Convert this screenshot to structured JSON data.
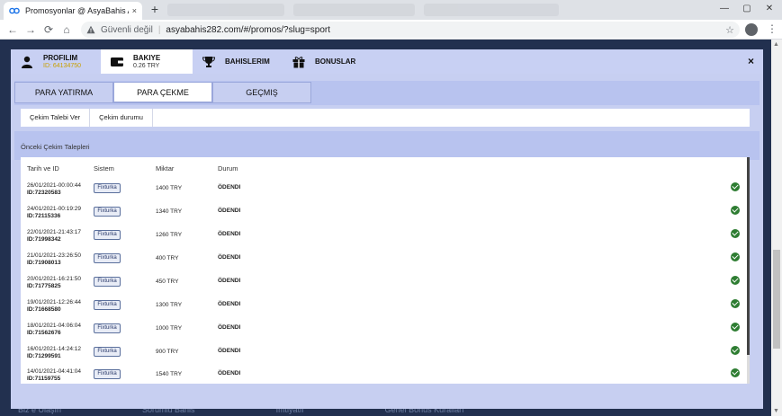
{
  "browser": {
    "tab_title": "Promosyonlar @ AsyaBahis Avru",
    "tab_close": "×",
    "new_tab": "+",
    "security_label": "Güvenli değil",
    "url": "asyabahis282.com/#/promos/?slug=sport",
    "nav": {
      "back": "←",
      "forward": "→",
      "reload": "⟳",
      "home": "⌂"
    },
    "star": "☆",
    "menu": "⋮",
    "window": {
      "minimize": "—",
      "maximize": "▢",
      "close": "✕"
    }
  },
  "modal": {
    "tabs": [
      {
        "label": "PROFILIM",
        "sub": "ID: 64134750",
        "icon": "user-icon"
      },
      {
        "label": "BAKIYE",
        "sub": "0.26 TRY",
        "icon": "wallet-icon"
      },
      {
        "label": "BAHISLERIM",
        "sub": "",
        "icon": "trophy-icon"
      },
      {
        "label": "BONUSLAR",
        "sub": "",
        "icon": "gift-icon"
      }
    ],
    "close": "×",
    "subtabs": [
      "PARA YATIRMA",
      "PARA ÇEKME",
      "GEÇMIŞ"
    ],
    "active_subtab": "PARA ÇEKME",
    "actions": [
      "Çekim Talebi Ver",
      "Çekim durumu"
    ],
    "section_title": "Önceki Çekim Talepleri",
    "columns": [
      "Tarih ve ID",
      "Sistem",
      "Miktar",
      "Durum"
    ],
    "rows": [
      {
        "date": "26/01/2021-00:00:44",
        "id": "ID:72320583",
        "system": "Fixturka",
        "amount": "1400 TRY",
        "status": "ÖDENDI"
      },
      {
        "date": "24/01/2021-00:19:29",
        "id": "ID:72115336",
        "system": "Fixturka",
        "amount": "1340 TRY",
        "status": "ÖDENDI"
      },
      {
        "date": "22/01/2021-21:43:17",
        "id": "ID:71998342",
        "system": "Fixturka",
        "amount": "1260 TRY",
        "status": "ÖDENDI"
      },
      {
        "date": "21/01/2021-23:26:50",
        "id": "ID:71908013",
        "system": "Fixturka",
        "amount": "400 TRY",
        "status": "ÖDENDI"
      },
      {
        "date": "20/01/2021-16:21:50",
        "id": "ID:71775825",
        "system": "Fixturka",
        "amount": "450 TRY",
        "status": "ÖDENDI"
      },
      {
        "date": "19/01/2021-12:26:44",
        "id": "ID:71668580",
        "system": "Fixturka",
        "amount": "1300 TRY",
        "status": "ÖDENDI"
      },
      {
        "date": "18/01/2021-04:06:04",
        "id": "ID:71562676",
        "system": "Fixturka",
        "amount": "1000 TRY",
        "status": "ÖDENDI"
      },
      {
        "date": "16/01/2021-14:24:12",
        "id": "ID:71299591",
        "system": "Fixturka",
        "amount": "900 TRY",
        "status": "ÖDENDI"
      },
      {
        "date": "14/01/2021-04:41:04",
        "id": "ID:71159755",
        "system": "Fixturka",
        "amount": "1540 TRY",
        "status": "ÖDENDI"
      }
    ]
  },
  "footer": {
    "links": [
      "Biz e Ulaşın",
      "Sorumlu Bahis",
      "İmtiyatlı",
      "Genel Bonus Kuralları"
    ]
  },
  "colors": {
    "modal_bg": "#c7cff1",
    "band": "#b8c3ef",
    "success": "#2e7d32",
    "id_gold": "#c9a000"
  }
}
